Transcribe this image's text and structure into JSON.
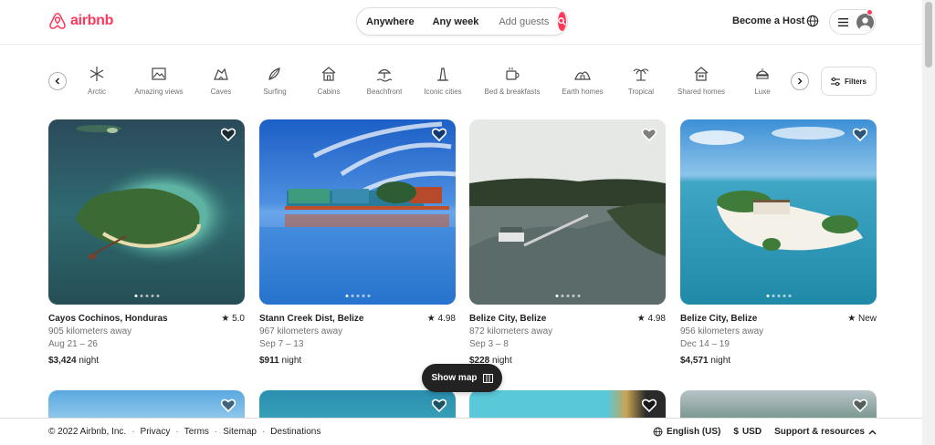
{
  "header": {
    "logo_text": "airbnb",
    "search": {
      "anywhere": "Anywhere",
      "any_week": "Any week",
      "add_guests": "Add guests"
    },
    "become_host": "Become a Host"
  },
  "categories": [
    {
      "label": "Arctic",
      "icon": "snowflake-icon"
    },
    {
      "label": "Amazing views",
      "icon": "view-icon"
    },
    {
      "label": "Caves",
      "icon": "cave-icon"
    },
    {
      "label": "Surfing",
      "icon": "surfboard-icon"
    },
    {
      "label": "Cabins",
      "icon": "cabin-icon"
    },
    {
      "label": "Beachfront",
      "icon": "beach-icon"
    },
    {
      "label": "Iconic cities",
      "icon": "city-icon"
    },
    {
      "label": "Bed & breakfasts",
      "icon": "coffee-icon"
    },
    {
      "label": "Earth homes",
      "icon": "earth-home-icon"
    },
    {
      "label": "Tropical",
      "icon": "palm-icon"
    },
    {
      "label": "Shared homes",
      "icon": "shared-home-icon"
    },
    {
      "label": "Luxe",
      "icon": "luxe-icon"
    }
  ],
  "filters_label": "Filters",
  "listings": [
    {
      "title": "Cayos Cochinos, Honduras",
      "rating": "5.0",
      "distance": "905 kilometers away",
      "dates": "Aug 21 – 26",
      "price": "$3,424",
      "price_unit": "night"
    },
    {
      "title": "Stann Creek Dist, Belize",
      "rating": "4.98",
      "distance": "967 kilometers away",
      "dates": "Sep 7 – 13",
      "price": "$911",
      "price_unit": "night"
    },
    {
      "title": "Belize City, Belize",
      "rating": "4.98",
      "distance": "872 kilometers away",
      "dates": "Sep 3 – 8",
      "price": "$228",
      "price_unit": "night"
    },
    {
      "title": "Belize City, Belize",
      "rating": "New",
      "distance": "956 kilometers away",
      "dates": "Dec 14 – 19",
      "price": "$4,571",
      "price_unit": "night"
    }
  ],
  "show_map": "Show map",
  "footer": {
    "copyright": "© 2022 Airbnb, Inc.",
    "links": [
      "Privacy",
      "Terms",
      "Sitemap",
      "Destinations"
    ],
    "language": "English (US)",
    "currency_symbol": "$",
    "currency": "USD",
    "support": "Support & resources"
  },
  "colors": {
    "brand": "#ff385c",
    "text": "#222222",
    "muted": "#717171"
  }
}
